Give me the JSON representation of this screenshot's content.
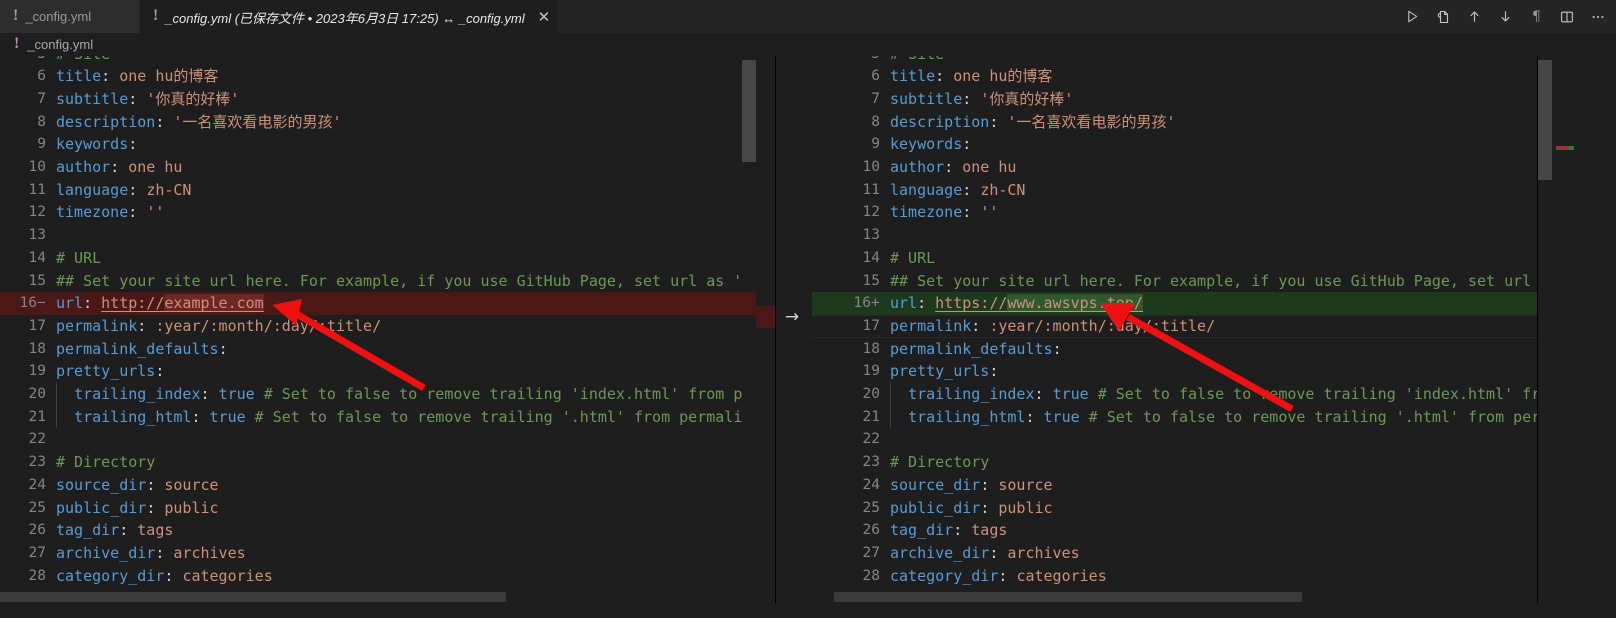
{
  "window": {
    "title": "_config.yml — diff editor",
    "theme_bg": "#1e1e1e",
    "accent_added": "#1e3a1e",
    "accent_removed": "#4b1818",
    "annotation_color": "#ee1111"
  },
  "tabs": [
    {
      "id": "tab-inactive",
      "icon": "yaml-file-icon",
      "label": "_config.yml",
      "active": false,
      "close_label": ""
    },
    {
      "id": "tab-active",
      "icon": "yaml-file-icon",
      "label": "_config.yml (已保存文件 • 2023年6月3日 17:25) ↔ _config.yml",
      "active": true,
      "close_label": "✕"
    }
  ],
  "toolbar": {
    "buttons": [
      {
        "name": "run-icon",
        "glyph": "▷",
        "title": "Run"
      },
      {
        "name": "split-file-icon",
        "glyph": "⎘",
        "title": "Compare"
      },
      {
        "name": "previous-change-icon",
        "glyph": "↑",
        "title": "Previous Change"
      },
      {
        "name": "next-change-icon",
        "glyph": "↓",
        "title": "Next Change"
      },
      {
        "name": "whitespace-pilcrow-icon",
        "glyph": "¶",
        "title": "Toggle Whitespace"
      },
      {
        "name": "split-editor-icon",
        "glyph": "▯▯",
        "title": "Split Editor"
      },
      {
        "name": "more-actions-icon",
        "glyph": "⋯",
        "title": "More Actions..."
      }
    ]
  },
  "breadcrumb": {
    "icon": "yaml-file-icon",
    "label": "_config.yml"
  },
  "diff": {
    "left_label": "_config.yml (已保存文件)",
    "right_label": "_config.yml",
    "change_marker": "→",
    "removed_sign": "−",
    "added_sign": "+"
  },
  "left_pane": {
    "first_visible_line": 5,
    "lines": [
      {
        "n": "5",
        "mark": "",
        "kind": "partial",
        "segments": [
          {
            "t": "# Site",
            "c": "c"
          }
        ]
      },
      {
        "n": "6",
        "mark": "",
        "kind": "normal",
        "segments": [
          {
            "t": "title",
            "c": "k"
          },
          {
            "t": ": ",
            "c": "p"
          },
          {
            "t": "one hu的博客",
            "c": "v"
          }
        ]
      },
      {
        "n": "7",
        "mark": "",
        "kind": "normal",
        "segments": [
          {
            "t": "subtitle",
            "c": "k"
          },
          {
            "t": ": ",
            "c": "p"
          },
          {
            "t": "'你真的好棒'",
            "c": "v"
          }
        ]
      },
      {
        "n": "8",
        "mark": "",
        "kind": "normal",
        "segments": [
          {
            "t": "description",
            "c": "k"
          },
          {
            "t": ": ",
            "c": "p"
          },
          {
            "t": "'一名喜欢看电影的男孩'",
            "c": "v"
          }
        ]
      },
      {
        "n": "9",
        "mark": "",
        "kind": "normal",
        "segments": [
          {
            "t": "keywords",
            "c": "k"
          },
          {
            "t": ":",
            "c": "p"
          }
        ]
      },
      {
        "n": "10",
        "mark": "",
        "kind": "normal",
        "segments": [
          {
            "t": "author",
            "c": "k"
          },
          {
            "t": ": ",
            "c": "p"
          },
          {
            "t": "one hu",
            "c": "v"
          }
        ]
      },
      {
        "n": "11",
        "mark": "",
        "kind": "normal",
        "segments": [
          {
            "t": "language",
            "c": "k"
          },
          {
            "t": ": ",
            "c": "p"
          },
          {
            "t": "zh-CN",
            "c": "v"
          }
        ]
      },
      {
        "n": "12",
        "mark": "",
        "kind": "normal",
        "segments": [
          {
            "t": "timezone",
            "c": "k"
          },
          {
            "t": ": ",
            "c": "p"
          },
          {
            "t": "''",
            "c": "v"
          }
        ]
      },
      {
        "n": "13",
        "mark": "",
        "kind": "normal",
        "segments": []
      },
      {
        "n": "14",
        "mark": "",
        "kind": "normal",
        "segments": [
          {
            "t": "# URL",
            "c": "c"
          }
        ]
      },
      {
        "n": "15",
        "mark": "",
        "kind": "normal",
        "segments": [
          {
            "t": "## Set your site url here. For example, if you use GitHub Page, set url as '",
            "c": "c"
          }
        ]
      },
      {
        "n": "16",
        "mark": "−",
        "kind": "removed",
        "segments": [
          {
            "t": "url",
            "c": "k"
          },
          {
            "t": ": ",
            "c": "p"
          },
          {
            "t": "http://",
            "c": "lnk"
          },
          {
            "t": "example.com",
            "c": "lnk inline-del"
          }
        ]
      },
      {
        "n": "17",
        "mark": "",
        "kind": "normal",
        "segments": [
          {
            "t": "permalink",
            "c": "k"
          },
          {
            "t": ": ",
            "c": "p"
          },
          {
            "t": ":year/:month/:day/:title/",
            "c": "v"
          }
        ]
      },
      {
        "n": "18",
        "mark": "",
        "kind": "normal",
        "segments": [
          {
            "t": "permalink_defaults",
            "c": "k"
          },
          {
            "t": ":",
            "c": "p"
          }
        ]
      },
      {
        "n": "19",
        "mark": "",
        "kind": "normal",
        "segments": [
          {
            "t": "pretty_urls",
            "c": "k"
          },
          {
            "t": ":",
            "c": "p"
          }
        ]
      },
      {
        "n": "20",
        "mark": "",
        "kind": "indent",
        "segments": [
          {
            "t": "  ",
            "c": "p"
          },
          {
            "t": "trailing_index",
            "c": "k"
          },
          {
            "t": ": ",
            "c": "p"
          },
          {
            "t": "true",
            "c": "b"
          },
          {
            "t": " # Set to false to remove trailing 'index.html' from p",
            "c": "c"
          }
        ]
      },
      {
        "n": "21",
        "mark": "",
        "kind": "indent",
        "segments": [
          {
            "t": "  ",
            "c": "p"
          },
          {
            "t": "trailing_html",
            "c": "k"
          },
          {
            "t": ": ",
            "c": "p"
          },
          {
            "t": "true",
            "c": "b"
          },
          {
            "t": " # Set to false to remove trailing '.html' from permali",
            "c": "c"
          }
        ]
      },
      {
        "n": "22",
        "mark": "",
        "kind": "normal",
        "segments": []
      },
      {
        "n": "23",
        "mark": "",
        "kind": "normal",
        "segments": [
          {
            "t": "# Directory",
            "c": "c"
          }
        ]
      },
      {
        "n": "24",
        "mark": "",
        "kind": "normal",
        "segments": [
          {
            "t": "source_dir",
            "c": "k"
          },
          {
            "t": ": ",
            "c": "p"
          },
          {
            "t": "source",
            "c": "v"
          }
        ]
      },
      {
        "n": "25",
        "mark": "",
        "kind": "normal",
        "segments": [
          {
            "t": "public_dir",
            "c": "k"
          },
          {
            "t": ": ",
            "c": "p"
          },
          {
            "t": "public",
            "c": "v"
          }
        ]
      },
      {
        "n": "26",
        "mark": "",
        "kind": "normal",
        "segments": [
          {
            "t": "tag_dir",
            "c": "k"
          },
          {
            "t": ": ",
            "c": "p"
          },
          {
            "t": "tags",
            "c": "v"
          }
        ]
      },
      {
        "n": "27",
        "mark": "",
        "kind": "normal",
        "segments": [
          {
            "t": "archive_dir",
            "c": "k"
          },
          {
            "t": ": ",
            "c": "p"
          },
          {
            "t": "archives",
            "c": "v"
          }
        ]
      },
      {
        "n": "28",
        "mark": "",
        "kind": "partial-bottom",
        "segments": [
          {
            "t": "category_dir",
            "c": "k"
          },
          {
            "t": ": ",
            "c": "p"
          },
          {
            "t": "categories",
            "c": "v"
          }
        ]
      }
    ]
  },
  "right_pane": {
    "first_visible_line": 5,
    "lines": [
      {
        "n": "5",
        "mark": "",
        "kind": "partial",
        "segments": [
          {
            "t": "# Site",
            "c": "c"
          }
        ]
      },
      {
        "n": "6",
        "mark": "",
        "kind": "normal",
        "segments": [
          {
            "t": "title",
            "c": "k"
          },
          {
            "t": ": ",
            "c": "p"
          },
          {
            "t": "one hu的博客",
            "c": "v"
          }
        ]
      },
      {
        "n": "7",
        "mark": "",
        "kind": "normal",
        "segments": [
          {
            "t": "subtitle",
            "c": "k"
          },
          {
            "t": ": ",
            "c": "p"
          },
          {
            "t": "'你真的好棒'",
            "c": "v"
          }
        ]
      },
      {
        "n": "8",
        "mark": "",
        "kind": "normal",
        "segments": [
          {
            "t": "description",
            "c": "k"
          },
          {
            "t": ": ",
            "c": "p"
          },
          {
            "t": "'一名喜欢看电影的男孩'",
            "c": "v"
          }
        ]
      },
      {
        "n": "9",
        "mark": "",
        "kind": "normal",
        "segments": [
          {
            "t": "keywords",
            "c": "k"
          },
          {
            "t": ":",
            "c": "p"
          }
        ]
      },
      {
        "n": "10",
        "mark": "",
        "kind": "normal",
        "segments": [
          {
            "t": "author",
            "c": "k"
          },
          {
            "t": ": ",
            "c": "p"
          },
          {
            "t": "one hu",
            "c": "v"
          }
        ]
      },
      {
        "n": "11",
        "mark": "",
        "kind": "normal",
        "segments": [
          {
            "t": "language",
            "c": "k"
          },
          {
            "t": ": ",
            "c": "p"
          },
          {
            "t": "zh-CN",
            "c": "v"
          }
        ]
      },
      {
        "n": "12",
        "mark": "",
        "kind": "normal",
        "segments": [
          {
            "t": "timezone",
            "c": "k"
          },
          {
            "t": ": ",
            "c": "p"
          },
          {
            "t": "''",
            "c": "v"
          }
        ]
      },
      {
        "n": "13",
        "mark": "",
        "kind": "normal",
        "segments": []
      },
      {
        "n": "14",
        "mark": "",
        "kind": "normal",
        "segments": [
          {
            "t": "# URL",
            "c": "c"
          }
        ]
      },
      {
        "n": "15",
        "mark": "",
        "kind": "normal",
        "segments": [
          {
            "t": "## Set your site url here. For example, if you use GitHub Page, set url as '",
            "c": "c"
          }
        ]
      },
      {
        "n": "16",
        "mark": "+",
        "kind": "added",
        "segments": [
          {
            "t": "url",
            "c": "k"
          },
          {
            "t": ": ",
            "c": "p"
          },
          {
            "t": "https://",
            "c": "lnk"
          },
          {
            "t": "www.awsvps.top/",
            "c": "lnk inline-add"
          }
        ]
      },
      {
        "n": "17",
        "mark": "",
        "kind": "current",
        "segments": [
          {
            "t": "permalink",
            "c": "k"
          },
          {
            "t": ": ",
            "c": "p"
          },
          {
            "t": ":year/:month/:day/:title/",
            "c": "v"
          }
        ]
      },
      {
        "n": "18",
        "mark": "",
        "kind": "normal",
        "segments": [
          {
            "t": "permalink_defaults",
            "c": "k"
          },
          {
            "t": ":",
            "c": "p"
          }
        ]
      },
      {
        "n": "19",
        "mark": "",
        "kind": "normal",
        "segments": [
          {
            "t": "pretty_urls",
            "c": "k"
          },
          {
            "t": ":",
            "c": "p"
          }
        ]
      },
      {
        "n": "20",
        "mark": "",
        "kind": "indent",
        "segments": [
          {
            "t": "  ",
            "c": "p"
          },
          {
            "t": "trailing_index",
            "c": "k"
          },
          {
            "t": ": ",
            "c": "p"
          },
          {
            "t": "true",
            "c": "b"
          },
          {
            "t": " # Set to false to remove trailing 'index.html' from p",
            "c": "c"
          }
        ]
      },
      {
        "n": "21",
        "mark": "",
        "kind": "indent",
        "segments": [
          {
            "t": "  ",
            "c": "p"
          },
          {
            "t": "trailing_html",
            "c": "k"
          },
          {
            "t": ": ",
            "c": "p"
          },
          {
            "t": "true",
            "c": "b"
          },
          {
            "t": " # Set to false to remove trailing '.html' from permali",
            "c": "c"
          }
        ]
      },
      {
        "n": "22",
        "mark": "",
        "kind": "normal",
        "segments": []
      },
      {
        "n": "23",
        "mark": "",
        "kind": "normal",
        "segments": [
          {
            "t": "# Directory",
            "c": "c"
          }
        ]
      },
      {
        "n": "24",
        "mark": "",
        "kind": "normal",
        "segments": [
          {
            "t": "source_dir",
            "c": "k"
          },
          {
            "t": ": ",
            "c": "p"
          },
          {
            "t": "source",
            "c": "v"
          }
        ]
      },
      {
        "n": "25",
        "mark": "",
        "kind": "normal",
        "segments": [
          {
            "t": "public_dir",
            "c": "k"
          },
          {
            "t": ": ",
            "c": "p"
          },
          {
            "t": "public",
            "c": "v"
          }
        ]
      },
      {
        "n": "26",
        "mark": "",
        "kind": "normal",
        "segments": [
          {
            "t": "tag_dir",
            "c": "k"
          },
          {
            "t": ": ",
            "c": "p"
          },
          {
            "t": "tags",
            "c": "v"
          }
        ]
      },
      {
        "n": "27",
        "mark": "",
        "kind": "normal",
        "segments": [
          {
            "t": "archive_dir",
            "c": "k"
          },
          {
            "t": ": ",
            "c": "p"
          },
          {
            "t": "archives",
            "c": "v"
          }
        ]
      },
      {
        "n": "28",
        "mark": "",
        "kind": "partial-bottom",
        "segments": [
          {
            "t": "category_dir",
            "c": "k"
          },
          {
            "t": ": ",
            "c": "p"
          },
          {
            "t": "categories",
            "c": "v"
          }
        ]
      }
    ]
  },
  "annotations": [
    {
      "name": "arrow-left-url",
      "target": "left url value http://example.com"
    },
    {
      "name": "arrow-right-url",
      "target": "right url value https://www.awsvps.top/"
    }
  ]
}
